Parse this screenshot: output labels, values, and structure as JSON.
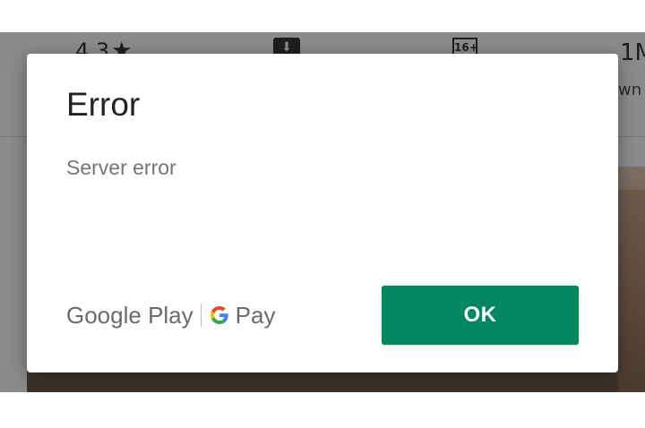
{
  "background_app": {
    "rating": "4.3",
    "rating_icon": "star-icon",
    "download_icon": "download-icon",
    "age_rating": "16+",
    "downloads": "1M",
    "downloads_caption": "wn"
  },
  "dialog": {
    "title": "Error",
    "message": "Server error",
    "branding": {
      "google_play": "Google Play",
      "g_pay_icon": "google-g-icon",
      "pay": "Pay"
    },
    "ok_button": "OK"
  },
  "colors": {
    "accent": "#01875f",
    "title_text": "#212121",
    "message_text": "#757575",
    "scrim": "#8a8a8a"
  }
}
